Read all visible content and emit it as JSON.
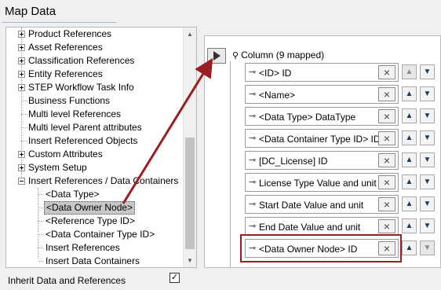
{
  "title": "Map Data",
  "tree": {
    "items": [
      {
        "label": "Product References",
        "expand": "+"
      },
      {
        "label": "Asset References",
        "expand": "+"
      },
      {
        "label": "Classification References",
        "expand": "+"
      },
      {
        "label": "Entity References",
        "expand": "+"
      },
      {
        "label": "STEP Workflow Task Info",
        "expand": "+"
      },
      {
        "label": "Business Functions",
        "expand": ""
      },
      {
        "label": "Multi level References",
        "expand": ""
      },
      {
        "label": "Multi level Parent attributes",
        "expand": ""
      },
      {
        "label": "Insert Referenced Objects",
        "expand": ""
      },
      {
        "label": "Custom Attributes",
        "expand": "+"
      },
      {
        "label": "System Setup",
        "expand": "+"
      },
      {
        "label": "Insert References / Data Containers",
        "expand": "-"
      }
    ],
    "children": [
      {
        "label": "<Data Type>"
      },
      {
        "label": "<Data Owner Node>"
      },
      {
        "label": "<Reference Type ID>"
      },
      {
        "label": "<Data Container Type ID>"
      },
      {
        "label": "Insert References"
      },
      {
        "label": "Insert Data Containers"
      }
    ],
    "selected_child": "<Data Owner Node>"
  },
  "inherit": {
    "label": "Inherit Data and References",
    "checked": true,
    "check_glyph": "✓"
  },
  "column": {
    "header": "Column (9 mapped)",
    "fields": [
      {
        "label": "<ID> ID"
      },
      {
        "label": "<Name>"
      },
      {
        "label": "<Data Type> DataType"
      },
      {
        "label": "<Data Container Type ID> ID"
      },
      {
        "label": "[DC_License] ID"
      },
      {
        "label": "License Type Value and unit"
      },
      {
        "label": "Start Date Value and unit"
      },
      {
        "label": "End Date Value and unit"
      },
      {
        "label": "<Data Owner Node> ID"
      }
    ],
    "highlighted_field": "<Data Owner Node> ID"
  },
  "colors": {
    "highlight": "#9b1c22",
    "arrow": "#9b1c22",
    "selection": "#c7c7c7"
  },
  "icons": {
    "remove": "×",
    "up": "▲",
    "down": "▼",
    "key": "⊸",
    "pin": "⚲"
  }
}
